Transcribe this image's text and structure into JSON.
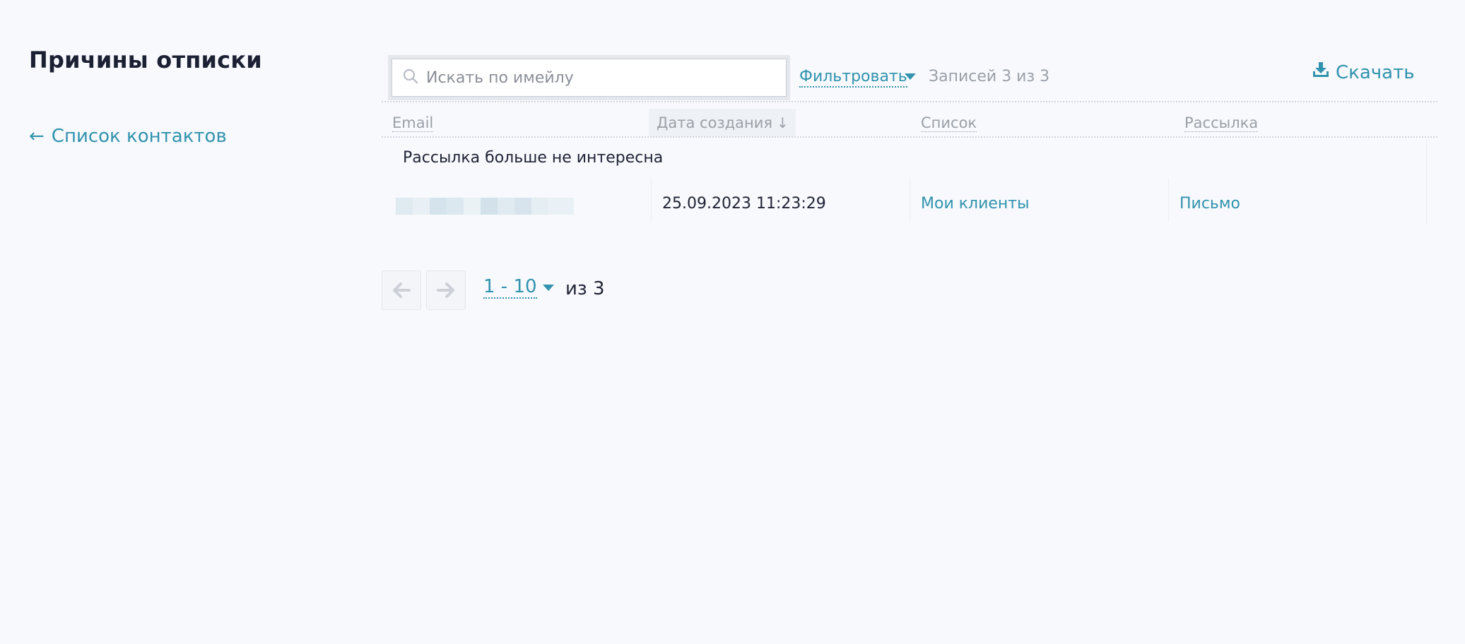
{
  "page": {
    "title": "Причины отписки",
    "back_link": {
      "arrow": "←",
      "label": "Список контактов"
    }
  },
  "toolbar": {
    "search_placeholder": "Искать по имейлу",
    "filter_label": "Фильтровать",
    "records_count": "Записей 3 из 3",
    "download_label": "Скачать"
  },
  "table": {
    "columns": [
      {
        "label": "Email"
      },
      {
        "label": "Дата создания",
        "sort_icon": "↓",
        "sorted": "desc"
      },
      {
        "label": "Список"
      },
      {
        "label": "Рассылка"
      }
    ],
    "groups": [
      {
        "label": "Рассылка больше не интересна",
        "rows": [
          {
            "email": "",
            "date": "25.09.2023 11:23:29",
            "list": "Мои клиенты",
            "campaign": "Письмо"
          }
        ]
      }
    ]
  },
  "pagination": {
    "prev_icon": "arrow-left-icon",
    "next_icon": "arrow-right-icon",
    "range": "1 - 10",
    "total": "из 3"
  },
  "colors": {
    "accent": "#3193ad",
    "background": "#f7f9fd",
    "text": "#1f2233",
    "muted": "#9ba0a8"
  }
}
